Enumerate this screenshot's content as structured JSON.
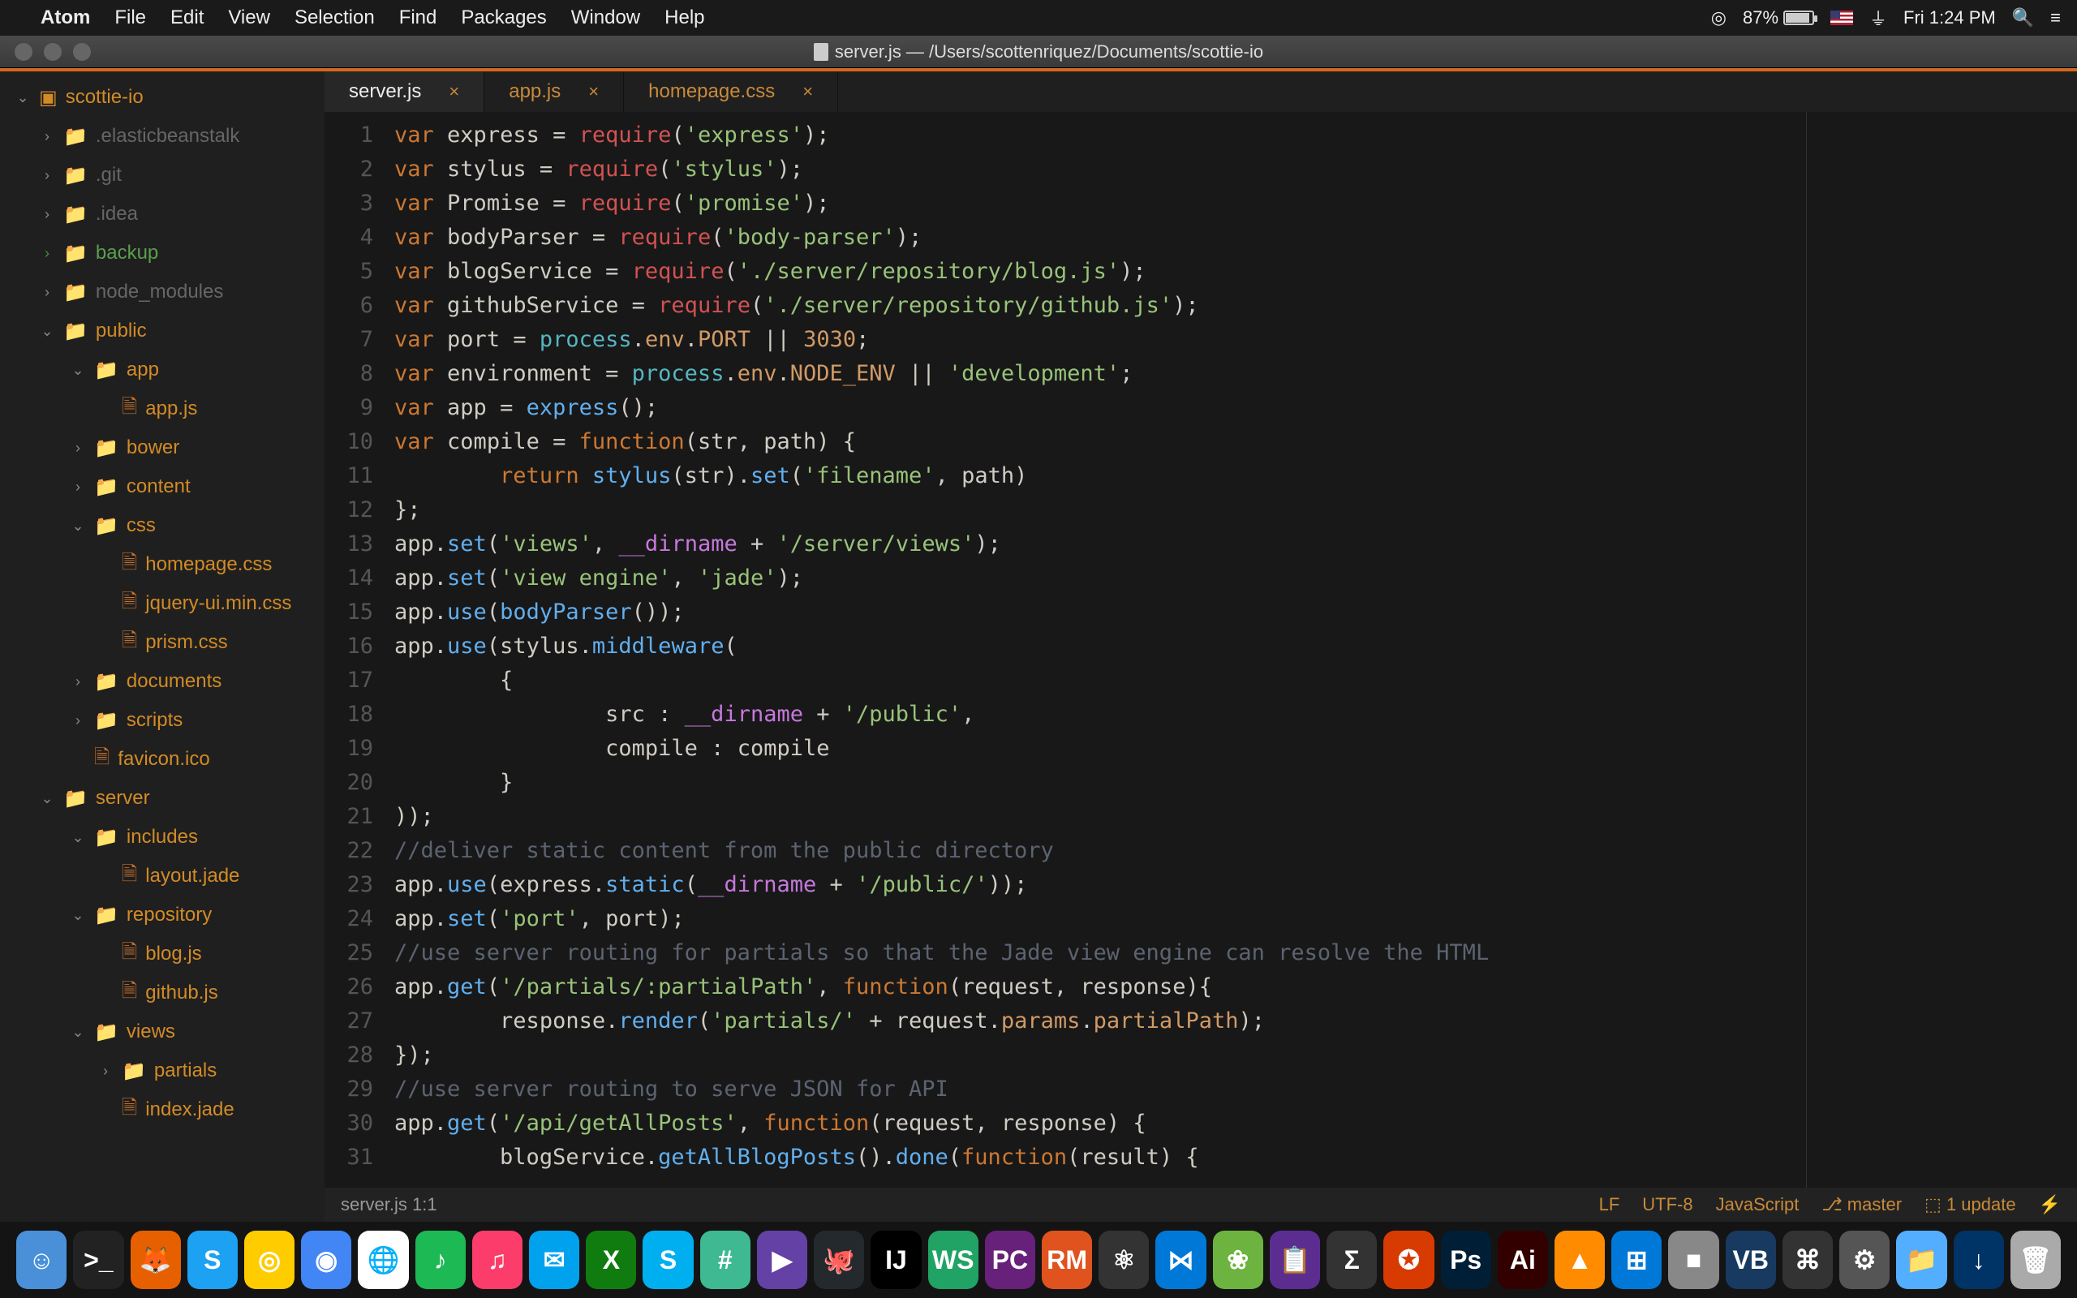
{
  "menubar": {
    "app": "Atom",
    "items": [
      "File",
      "Edit",
      "View",
      "Selection",
      "Find",
      "Packages",
      "Window",
      "Help"
    ],
    "battery": "87%",
    "clock": "Fri 1:24 PM"
  },
  "window_title": "server.js — /Users/scottenriquez/Documents/scottie-io",
  "sidebar_root": "scottie-io",
  "tree": [
    {
      "indent": 1,
      "chev": "›",
      "kind": "fold",
      "cls": "ignored",
      "label": ".elasticbeanstalk"
    },
    {
      "indent": 1,
      "chev": "›",
      "kind": "fold",
      "cls": "ignored",
      "label": ".git"
    },
    {
      "indent": 1,
      "chev": "›",
      "kind": "fold",
      "cls": "ignored",
      "label": ".idea"
    },
    {
      "indent": 1,
      "chev": "›",
      "kind": "fold",
      "cls": "green",
      "chevcls": "green",
      "foldcls": "green",
      "label": "backup"
    },
    {
      "indent": 1,
      "chev": "›",
      "kind": "fold",
      "cls": "ignored",
      "label": "node_modules"
    },
    {
      "indent": 1,
      "chev": "⌄",
      "kind": "fold",
      "cls": "modified",
      "foldcls": "orange",
      "label": "public"
    },
    {
      "indent": 2,
      "chev": "⌄",
      "kind": "fold",
      "cls": "modified",
      "foldcls": "orange",
      "label": "app"
    },
    {
      "indent": 3,
      "chev": "",
      "kind": "file",
      "cls": "modified",
      "label": "app.js"
    },
    {
      "indent": 2,
      "chev": "›",
      "kind": "fold",
      "cls": "modified",
      "foldcls": "orange",
      "label": "bower"
    },
    {
      "indent": 2,
      "chev": "›",
      "kind": "fold",
      "cls": "modified",
      "foldcls": "orange",
      "label": "content"
    },
    {
      "indent": 2,
      "chev": "⌄",
      "kind": "fold",
      "cls": "modified",
      "foldcls": "orange",
      "label": "css"
    },
    {
      "indent": 3,
      "chev": "",
      "kind": "file",
      "cls": "modified",
      "label": "homepage.css"
    },
    {
      "indent": 3,
      "chev": "",
      "kind": "file",
      "cls": "modified",
      "label": "jquery-ui.min.css"
    },
    {
      "indent": 3,
      "chev": "",
      "kind": "file",
      "cls": "modified",
      "label": "prism.css"
    },
    {
      "indent": 2,
      "chev": "›",
      "kind": "fold",
      "cls": "modified",
      "foldcls": "orange",
      "label": "documents"
    },
    {
      "indent": 2,
      "chev": "›",
      "kind": "fold",
      "cls": "modified",
      "foldcls": "orange",
      "label": "scripts"
    },
    {
      "indent": 2,
      "chev": "",
      "kind": "file",
      "cls": "modified",
      "label": "favicon.ico"
    },
    {
      "indent": 1,
      "chev": "⌄",
      "kind": "fold",
      "cls": "modified",
      "foldcls": "orange",
      "label": "server"
    },
    {
      "indent": 2,
      "chev": "⌄",
      "kind": "fold",
      "cls": "modified",
      "foldcls": "orange",
      "label": "includes"
    },
    {
      "indent": 3,
      "chev": "",
      "kind": "file",
      "cls": "modified",
      "label": "layout.jade"
    },
    {
      "indent": 2,
      "chev": "⌄",
      "kind": "fold",
      "cls": "modified",
      "foldcls": "orange",
      "label": "repository"
    },
    {
      "indent": 3,
      "chev": "",
      "kind": "file",
      "cls": "modified",
      "label": "blog.js"
    },
    {
      "indent": 3,
      "chev": "",
      "kind": "file",
      "cls": "modified",
      "label": "github.js"
    },
    {
      "indent": 2,
      "chev": "⌄",
      "kind": "fold",
      "cls": "modified",
      "foldcls": "orange",
      "label": "views"
    },
    {
      "indent": 3,
      "chev": "›",
      "kind": "fold",
      "cls": "modified",
      "foldcls": "orange",
      "label": "partials"
    },
    {
      "indent": 3,
      "chev": "",
      "kind": "file",
      "cls": "modified",
      "label": "index.jade"
    }
  ],
  "tabs": [
    {
      "label": "server.js",
      "active": true
    },
    {
      "label": "app.js",
      "active": false
    },
    {
      "label": "homepage.css",
      "active": false
    }
  ],
  "code_lines": [
    "<span class='kw'>var</span> <span class='id'>express</span> <span class='pun'>=</span> <span class='req'>require</span><span class='pun'>(</span><span class='str'>'express'</span><span class='pun'>);</span>",
    "<span class='kw'>var</span> <span class='id'>stylus</span> <span class='pun'>=</span> <span class='req'>require</span><span class='pun'>(</span><span class='str'>'stylus'</span><span class='pun'>);</span>",
    "<span class='kw'>var</span> <span class='id'>Promise</span> <span class='pun'>=</span> <span class='req'>require</span><span class='pun'>(</span><span class='str'>'promise'</span><span class='pun'>);</span>",
    "<span class='kw'>var</span> <span class='id'>bodyParser</span> <span class='pun'>=</span> <span class='req'>require</span><span class='pun'>(</span><span class='str'>'body-parser'</span><span class='pun'>);</span>",
    "<span class='kw'>var</span> <span class='id'>blogService</span> <span class='pun'>=</span> <span class='req'>require</span><span class='pun'>(</span><span class='str'>'./server/repository/blog.js'</span><span class='pun'>);</span>",
    "<span class='kw'>var</span> <span class='id'>githubService</span> <span class='pun'>=</span> <span class='req'>require</span><span class='pun'>(</span><span class='str'>'./server/repository/github.js'</span><span class='pun'>);</span>",
    "<span class='kw'>var</span> <span class='id'>port</span> <span class='pun'>=</span> <span class='obj'>process</span><span class='pun'>.</span><span class='prop'>env</span><span class='pun'>.</span><span class='prop'>PORT</span> <span class='pun'>||</span> <span class='num'>3030</span><span class='pun'>;</span>",
    "<span class='kw'>var</span> <span class='id'>environment</span> <span class='pun'>=</span> <span class='obj'>process</span><span class='pun'>.</span><span class='prop'>env</span><span class='pun'>.</span><span class='prop'>NODE_ENV</span> <span class='pun'>||</span> <span class='str'>'development'</span><span class='pun'>;</span>",
    "<span class='kw'>var</span> <span class='id'>app</span> <span class='pun'>=</span> <span class='fn'>express</span><span class='pun'>();</span>",
    "<span class='kw'>var</span> <span class='id'>compile</span> <span class='pun'>=</span> <span class='kw'>function</span><span class='pun'>(</span><span class='id'>str</span><span class='pun'>,</span> <span class='id'>path</span><span class='pun'>) {</span>",
    "        <span class='kw'>return</span> <span class='fn'>stylus</span><span class='pun'>(</span><span class='id'>str</span><span class='pun'>).</span><span class='fn'>set</span><span class='pun'>(</span><span class='str'>'filename'</span><span class='pun'>,</span> <span class='id'>path</span><span class='pun'>)</span>",
    "<span class='pun'>};</span>",
    "<span class='id'>app</span><span class='pun'>.</span><span class='fn'>set</span><span class='pun'>(</span><span class='str'>'views'</span><span class='pun'>,</span> <span class='dn'>__dirname</span> <span class='pun'>+</span> <span class='str'>'/server/views'</span><span class='pun'>);</span>",
    "<span class='id'>app</span><span class='pun'>.</span><span class='fn'>set</span><span class='pun'>(</span><span class='str'>'view engine'</span><span class='pun'>,</span> <span class='str'>'jade'</span><span class='pun'>);</span>",
    "<span class='id'>app</span><span class='pun'>.</span><span class='fn'>use</span><span class='pun'>(</span><span class='fn'>bodyParser</span><span class='pun'>());</span>",
    "<span class='id'>app</span><span class='pun'>.</span><span class='fn'>use</span><span class='pun'>(</span><span class='id'>stylus</span><span class='pun'>.</span><span class='fn'>middleware</span><span class='pun'>(</span>",
    "        <span class='pun'>{</span>",
    "                <span class='id'>src</span> <span class='pun'>:</span> <span class='dn'>__dirname</span> <span class='pun'>+</span> <span class='str'>'/public'</span><span class='pun'>,</span>",
    "                <span class='id'>compile</span> <span class='pun'>:</span> <span class='id'>compile</span>",
    "        <span class='pun'>}</span>",
    "<span class='pun'>));</span>",
    "<span class='cm'>//deliver static content from the public directory</span>",
    "<span class='id'>app</span><span class='pun'>.</span><span class='fn'>use</span><span class='pun'>(</span><span class='id'>express</span><span class='pun'>.</span><span class='fn'>static</span><span class='pun'>(</span><span class='dn'>__dirname</span> <span class='pun'>+</span> <span class='str'>'/public/'</span><span class='pun'>));</span>",
    "<span class='id'>app</span><span class='pun'>.</span><span class='fn'>set</span><span class='pun'>(</span><span class='str'>'port'</span><span class='pun'>,</span> <span class='id'>port</span><span class='pun'>);</span>",
    "<span class='cm'>//use server routing for partials so that the Jade view engine can resolve the HTML</span>",
    "<span class='id'>app</span><span class='pun'>.</span><span class='fn'>get</span><span class='pun'>(</span><span class='str'>'/partials/:partialPath'</span><span class='pun'>,</span> <span class='kw'>function</span><span class='pun'>(</span><span class='id'>request</span><span class='pun'>,</span> <span class='id'>response</span><span class='pun'>){</span>",
    "        <span class='id'>response</span><span class='pun'>.</span><span class='fn'>render</span><span class='pun'>(</span><span class='str'>'partials/'</span> <span class='pun'>+</span> <span class='id'>request</span><span class='pun'>.</span><span class='prop'>params</span><span class='pun'>.</span><span class='prop'>partialPath</span><span class='pun'>);</span>",
    "<span class='pun'>});</span>",
    "<span class='cm'>//use server routing to serve JSON for API</span>",
    "<span class='id'>app</span><span class='pun'>.</span><span class='fn'>get</span><span class='pun'>(</span><span class='str'>'/api/getAllPosts'</span><span class='pun'>,</span> <span class='kw'>function</span><span class='pun'>(</span><span class='id'>request</span><span class='pun'>,</span> <span class='id'>response</span><span class='pun'>) {</span>",
    "        <span class='id'>blogService</span><span class='pun'>.</span><span class='fn'>getAllBlogPosts</span><span class='pun'>().</span><span class='fn'>done</span><span class='pun'>(</span><span class='kw'>function</span><span class='pun'>(</span><span class='id'>result</span><span class='pun'>) {</span>"
  ],
  "status": {
    "left": "server.js   1:1",
    "lf": "LF",
    "enc": "UTF-8",
    "lang": "JavaScript",
    "branch": "master",
    "updates": "1 update"
  },
  "dock_icons": [
    {
      "bg": "#4a90d9",
      "txt": "☺"
    },
    {
      "bg": "#222",
      "txt": ">_"
    },
    {
      "bg": "#e66000",
      "txt": "🦊"
    },
    {
      "bg": "#1da1f2",
      "txt": "S"
    },
    {
      "bg": "#ffcc00",
      "txt": "◎"
    },
    {
      "bg": "#4285f4",
      "txt": "◉"
    },
    {
      "bg": "#fff",
      "txt": "🌐"
    },
    {
      "bg": "#1db954",
      "txt": "♪"
    },
    {
      "bg": "#fc3d6b",
      "txt": "♫"
    },
    {
      "bg": "#00a2ed",
      "txt": "✉"
    },
    {
      "bg": "#107c10",
      "txt": "X"
    },
    {
      "bg": "#00aff0",
      "txt": "S"
    },
    {
      "bg": "#3eb991",
      "txt": "#"
    },
    {
      "bg": "#6441a5",
      "txt": "▶"
    },
    {
      "bg": "#24292e",
      "txt": "🐙"
    },
    {
      "bg": "#000",
      "txt": "IJ"
    },
    {
      "bg": "#21a366",
      "txt": "WS"
    },
    {
      "bg": "#68217a",
      "txt": "PC"
    },
    {
      "bg": "#e0531f",
      "txt": "RM"
    },
    {
      "bg": "#333",
      "txt": "⚛"
    },
    {
      "bg": "#0078d7",
      "txt": "⋈"
    },
    {
      "bg": "#6db33f",
      "txt": "❀"
    },
    {
      "bg": "#5c2d91",
      "txt": "📋"
    },
    {
      "bg": "#333",
      "txt": "Σ"
    },
    {
      "bg": "#d83b01",
      "txt": "✪"
    },
    {
      "bg": "#001e36",
      "txt": "Ps"
    },
    {
      "bg": "#330000",
      "txt": "Ai"
    },
    {
      "bg": "#ff8c00",
      "txt": "▲"
    },
    {
      "bg": "#0078d7",
      "txt": "⊞"
    },
    {
      "bg": "#888",
      "txt": "■"
    },
    {
      "bg": "#183a61",
      "txt": "VB"
    },
    {
      "bg": "#333",
      "txt": "⌘"
    },
    {
      "bg": "#555",
      "txt": "⚙"
    },
    {
      "bg": "#54aeff",
      "txt": "📁"
    },
    {
      "bg": "#003366",
      "txt": "↓"
    },
    {
      "bg": "#aaa",
      "txt": "🗑"
    }
  ]
}
